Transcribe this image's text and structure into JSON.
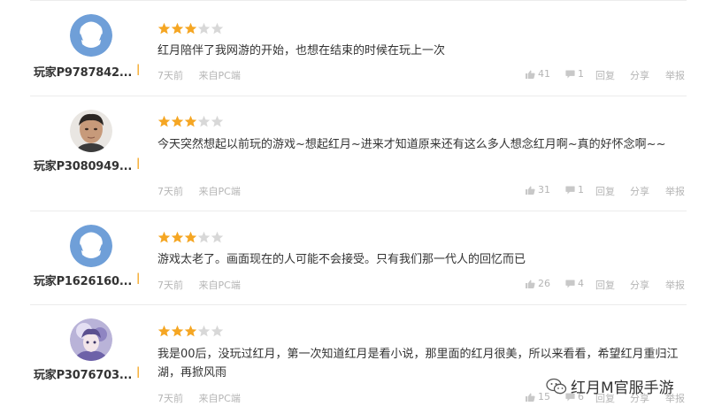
{
  "comments": [
    {
      "username": "玩家P9787842...",
      "avatar": "default-avatar",
      "rating": 3,
      "max_rating": 5,
      "text": "红月陪伴了我网游的开始，也想在结束的时候在玩上一次",
      "time": "7天前",
      "source": "来自PC端",
      "likes": "41",
      "replies": "1",
      "reply_label": "回复",
      "share_label": "分享",
      "report_label": "举报"
    },
    {
      "username": "玩家P3080949...",
      "avatar": "photo-avatar",
      "rating": 3,
      "max_rating": 5,
      "text": "今天突然想起以前玩的游戏~想起红月~进来才知道原来还有这么多人想念红月啊~真的好怀念啊~~",
      "time": "7天前",
      "source": "来自PC端",
      "likes": "31",
      "replies": "1",
      "reply_label": "回复",
      "share_label": "分享",
      "report_label": "举报"
    },
    {
      "username": "玩家P1626160...",
      "avatar": "default-avatar",
      "rating": 3,
      "max_rating": 5,
      "text": "游戏太老了。画面现在的人可能不会接受。只有我们那一代人的回忆而已",
      "time": "7天前",
      "source": "来自PC端",
      "likes": "26",
      "replies": "4",
      "reply_label": "回复",
      "share_label": "分享",
      "report_label": "举报"
    },
    {
      "username": "玩家P3076703...",
      "avatar": "anime-avatar",
      "rating": 3,
      "max_rating": 5,
      "text": "我是00后，没玩过红月，第一次知道红月是看小说，那里面的红月很美，所以来看看，希望红月重归江湖，再掀风雨",
      "time": "7天前",
      "source": "来自PC端",
      "likes": "15",
      "replies": "6",
      "reply_label": "回复",
      "share_label": "分享",
      "report_label": "举报"
    }
  ],
  "watermark": {
    "text": "红月M官服手游",
    "icon": "wechat-icon"
  },
  "colors": {
    "star_on": "#f5a623",
    "star_off": "#d8d8d8",
    "meta": "#b5b5b5",
    "text": "#333333",
    "avatar_default": "#6f9fd8"
  }
}
